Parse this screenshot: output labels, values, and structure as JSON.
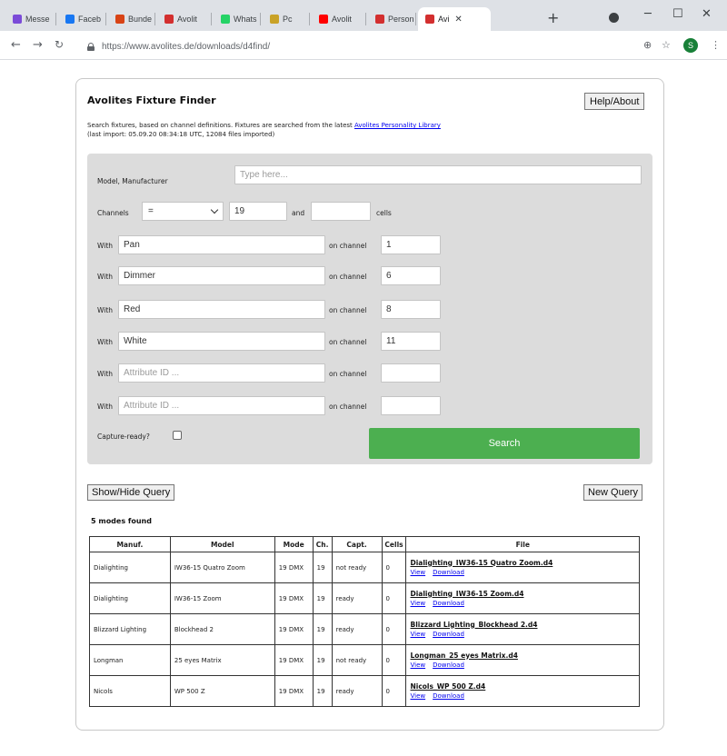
{
  "browser": {
    "tabs": [
      {
        "label": "Messe",
        "color": "#7b4bd8",
        "icon": "messenger-icon"
      },
      {
        "label": "Faceb",
        "color": "#1877f2",
        "icon": "facebook-icon"
      },
      {
        "label": "Bunde",
        "color": "#d84315",
        "icon": "bundle-icon"
      },
      {
        "label": "Avolit",
        "color": "#d32f2f",
        "icon": "avolites-icon"
      },
      {
        "label": "Whats",
        "color": "#25d366",
        "icon": "whatsapp-icon"
      },
      {
        "label": "Pc",
        "color": "#c9a227",
        "icon": "pencil-icon"
      },
      {
        "label": "Avolit",
        "color": "#ff0000",
        "icon": "youtube-icon"
      },
      {
        "label": "Person",
        "color": "#d32f2f",
        "icon": "avolites-icon"
      },
      {
        "label": "Avi",
        "color": "#d32f2f",
        "icon": "avolites-icon"
      }
    ],
    "active_tab_close": "✕",
    "new_tab": "+",
    "url": "https://www.avolites.de/downloads/d4find/",
    "avatar_letter": "S"
  },
  "page": {
    "title": "Avolites Fixture Finder",
    "help_label": "Help/About",
    "description_prefix": "Search fixtures, based on channel definitions. Fixtures are searched from the latest ",
    "description_link": "Avolites Personality Library",
    "description_import": "(last import: 05.09.20 08:34:18 UTC, 12084 files imported)"
  },
  "query": {
    "model_label": "Model, Manufacturer",
    "model_placeholder": "Type here...",
    "channels_label": "Channels",
    "channels_operator": "=",
    "channels_value": "19",
    "and_label": "and",
    "cells_value": "",
    "cells_label": "cells",
    "with_label": "With",
    "on_channel_label": "on channel",
    "attribute_placeholder": "Attribute ID ...",
    "rows": [
      {
        "attribute": "Pan",
        "channel": "1"
      },
      {
        "attribute": "Dimmer",
        "channel": "6"
      },
      {
        "attribute": "Red",
        "channel": "8"
      },
      {
        "attribute": "White",
        "channel": "11"
      },
      {
        "attribute": "",
        "channel": ""
      },
      {
        "attribute": "",
        "channel": ""
      }
    ],
    "capture_label": "Capture-ready?",
    "capture_checked": false,
    "search_label": "Search"
  },
  "actions": {
    "show_hide_label": "Show/Hide Query",
    "new_query_label": "New Query"
  },
  "results": {
    "count_text": "5 modes found",
    "headers": [
      "Manuf.",
      "Model",
      "Mode",
      "Ch.",
      "Capt.",
      "Cells",
      "File"
    ],
    "view_label": "View",
    "download_label": "Download",
    "rows": [
      {
        "manuf": "Dialighting",
        "model": "IW36-15 Quatro Zoom",
        "mode": "19 DMX",
        "ch": "19",
        "capt": "not ready",
        "cells": "0",
        "file": "Dialighting_IW36-15 Quatro Zoom.d4"
      },
      {
        "manuf": "Dialighting",
        "model": "IW36-15 Zoom",
        "mode": "19 DMX",
        "ch": "19",
        "capt": "ready",
        "cells": "0",
        "file": "Dialighting_IW36-15 Zoom.d4"
      },
      {
        "manuf": "Blizzard Lighting",
        "model": "Blockhead 2",
        "mode": "19 DMX",
        "ch": "19",
        "capt": "ready",
        "cells": "0",
        "file": "Blizzard Lighting_Blockhead 2.d4"
      },
      {
        "manuf": "Longman",
        "model": "25 eyes Matrix",
        "mode": "19 DMX",
        "ch": "19",
        "capt": "not ready",
        "cells": "0",
        "file": "Longman_25 eyes Matrix.d4"
      },
      {
        "manuf": "Nicols",
        "model": "WP 500 Z",
        "mode": "19 DMX",
        "ch": "19",
        "capt": "ready",
        "cells": "0",
        "file": "Nicols_WP 500 Z.d4"
      }
    ]
  }
}
